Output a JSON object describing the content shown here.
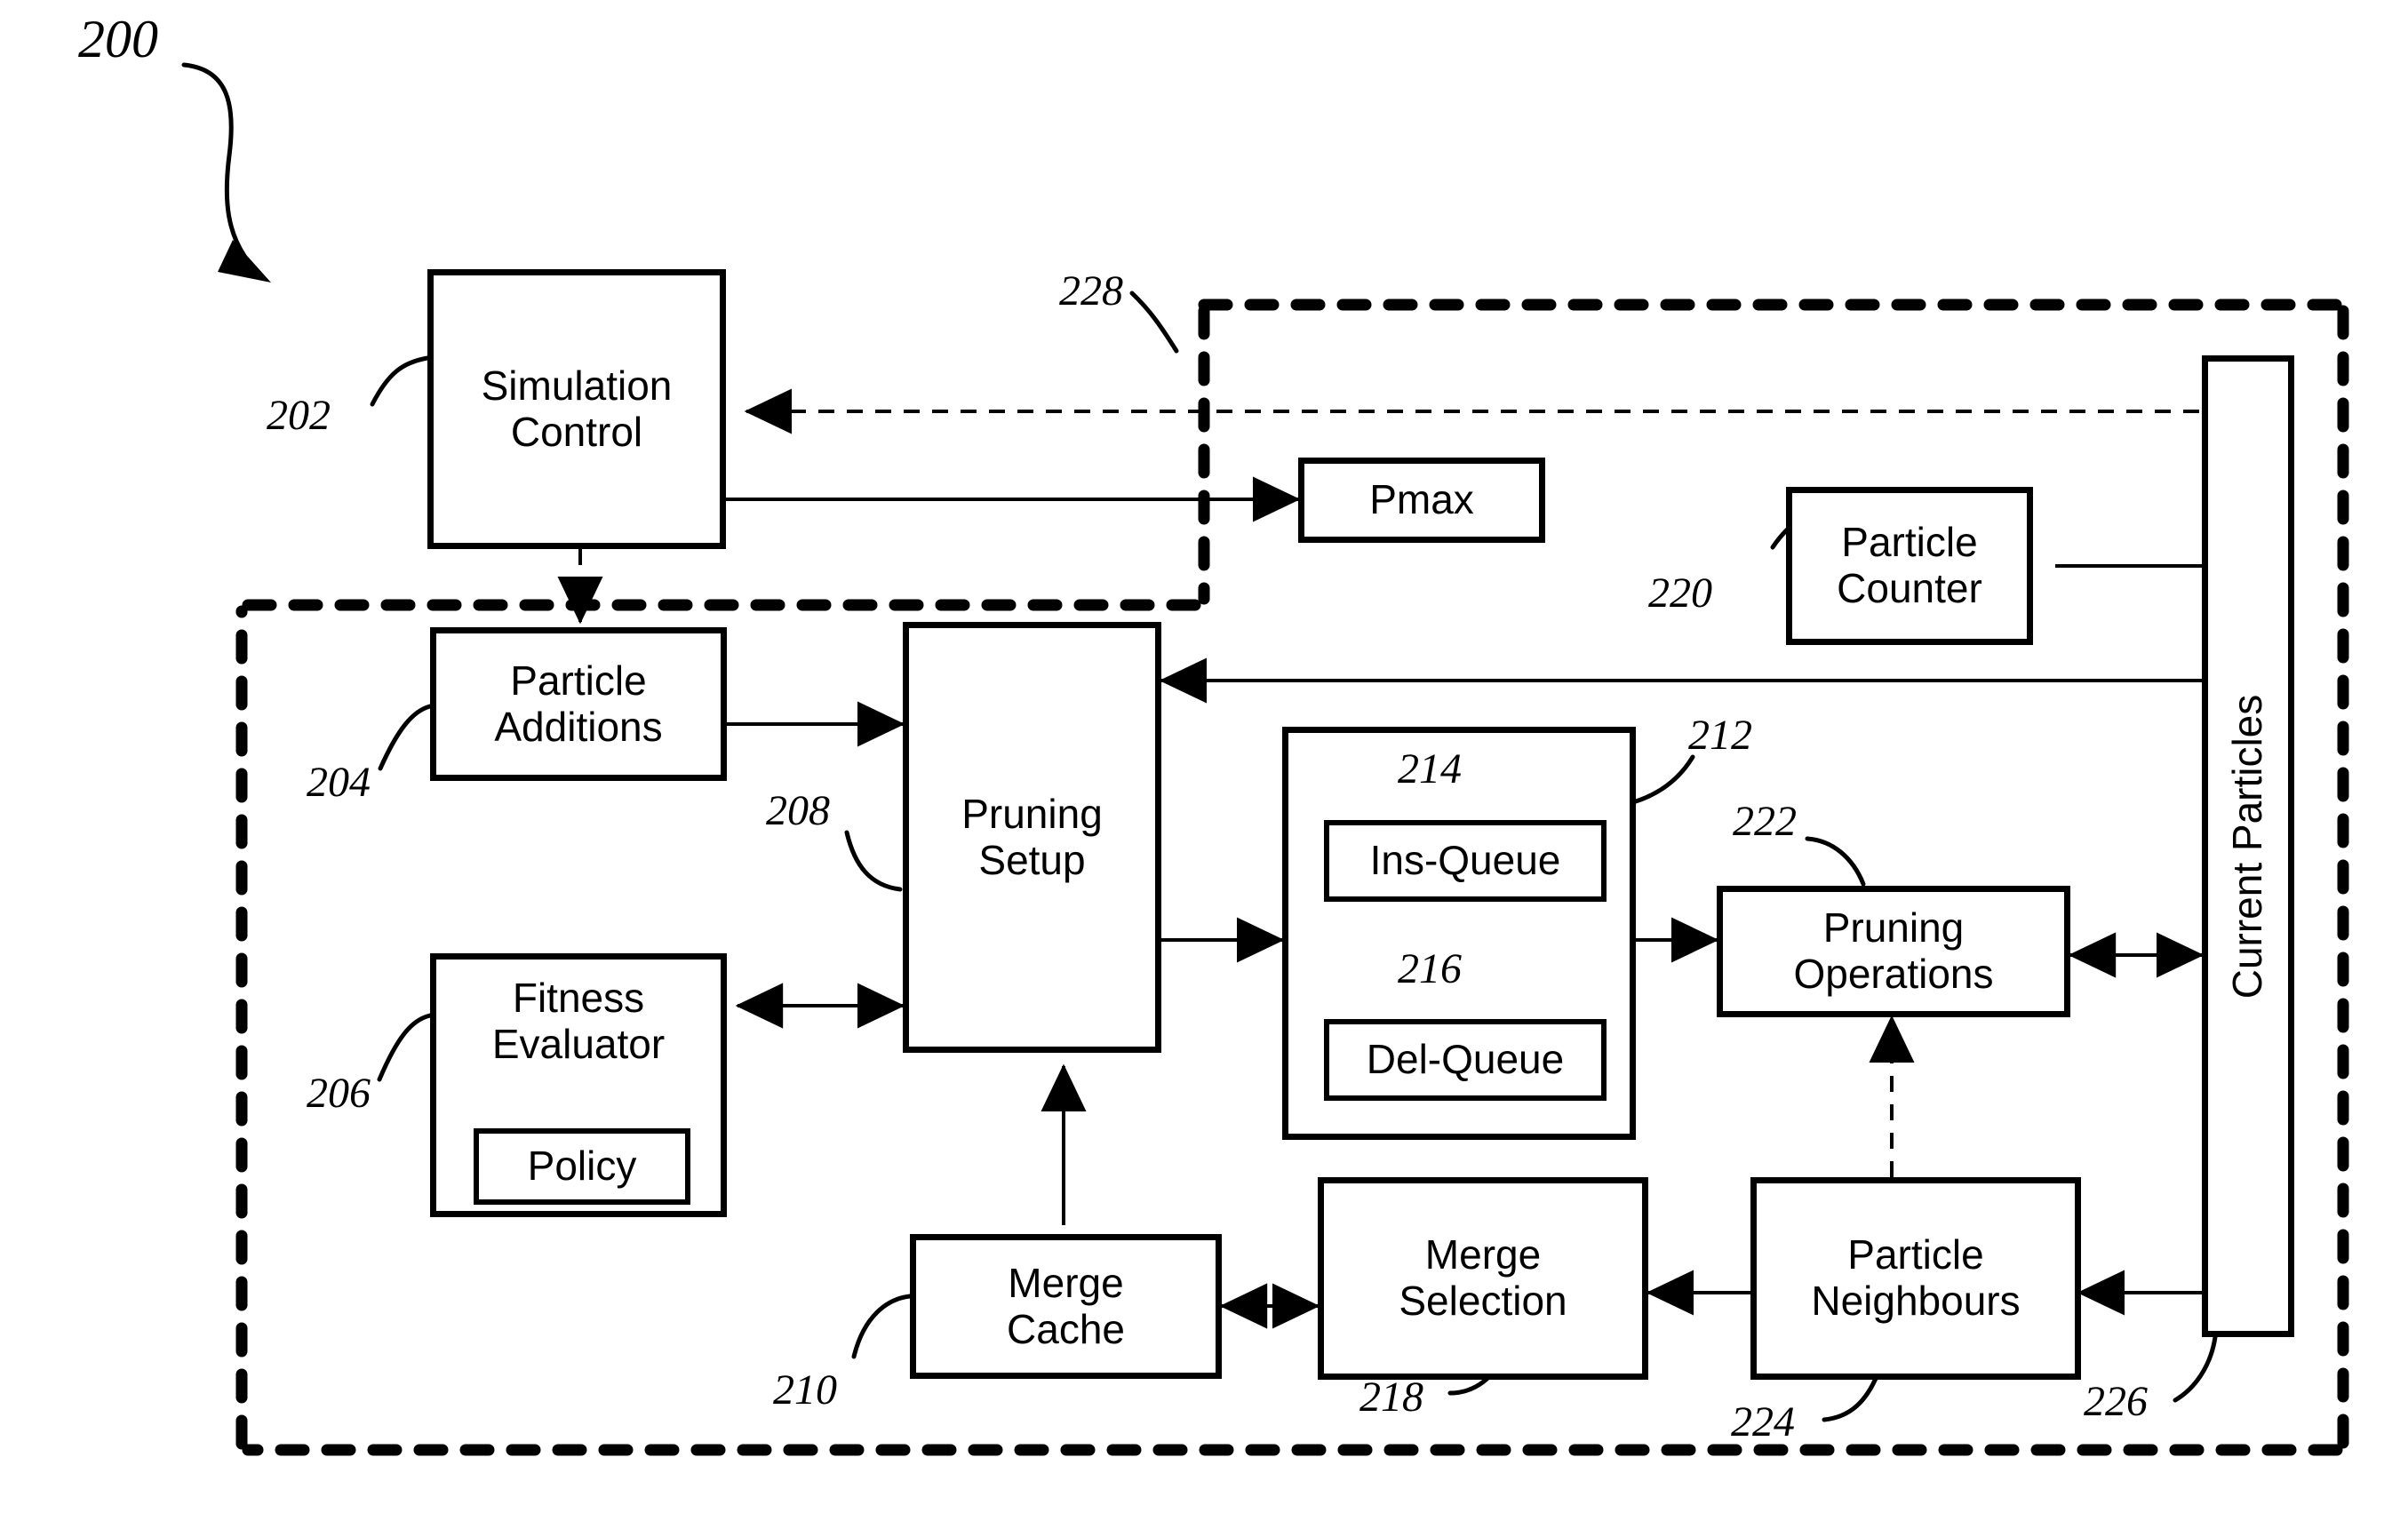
{
  "figure": {
    "number": "200",
    "title_ref": "200"
  },
  "blocks": {
    "simulation_control": {
      "label": "Simulation\nControl",
      "ref": "202"
    },
    "pmax": {
      "label": "Pmax",
      "ref": ""
    },
    "particle_additions": {
      "label": "Particle\nAdditions",
      "ref": "204"
    },
    "fitness_evaluator": {
      "label": "Fitness\nEvaluator",
      "ref": "206"
    },
    "policy": {
      "label": "Policy",
      "ref": ""
    },
    "pruning_setup": {
      "label": "Pruning\nSetup",
      "ref": "208"
    },
    "merge_cache": {
      "label": "Merge\nCache",
      "ref": "210"
    },
    "queue_container": {
      "label": "",
      "ref": "212"
    },
    "ins_queue": {
      "label": "Ins-Queue",
      "ref": "214"
    },
    "del_queue": {
      "label": "Del-Queue",
      "ref": "216"
    },
    "merge_selection": {
      "label": "Merge\nSelection",
      "ref": "218"
    },
    "particle_counter": {
      "label": "Particle\nCounter",
      "ref": "220"
    },
    "pruning_operations": {
      "label": "Pruning\nOperations",
      "ref": "222"
    },
    "particle_neighbours": {
      "label": "Particle\nNeighbours",
      "ref": "224"
    },
    "current_particles": {
      "label": "Current Particles",
      "ref": "226"
    },
    "outer_boundary": {
      "label": "",
      "ref": "228"
    }
  },
  "colors": {
    "stroke": "#000000",
    "background": "#ffffff"
  }
}
